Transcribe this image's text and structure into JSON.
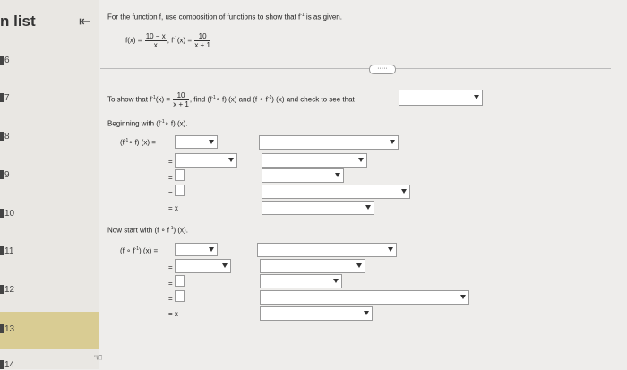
{
  "sidebar": {
    "title": "n list",
    "items": [
      {
        "label": "6"
      },
      {
        "label": "7"
      },
      {
        "label": "8"
      },
      {
        "label": "9"
      },
      {
        "label": "10"
      },
      {
        "label": "11"
      },
      {
        "label": "12"
      },
      {
        "label": "13"
      },
      {
        "label": "14"
      }
    ],
    "collapse_icon": "collapse-left-icon",
    "active_color": "#d9cc93"
  },
  "problem": {
    "instruction_1": "For the function f, use composition of functions to show that f",
    "instruction_1_sup": "-1",
    "instruction_1_end": "is as given.",
    "f_lhs": "f(x) =",
    "f_num": "10 − x",
    "f_den": "x",
    "sep": ",",
    "finv_lhs_f": "f",
    "finv_lhs_sup": "-1",
    "finv_lhs_x": "(x) =",
    "finv_num": "10",
    "finv_den": "x + 1",
    "more_label": "·····",
    "show_text_1": "To show that f",
    "show_sup": "-1",
    "show_text_2": "(x) =",
    "show_num": "10",
    "show_den": "x + 1",
    "show_text_3": ", find",
    "comp1": "(f",
    "comp1_sup": "-1",
    "comp1_end": "∘ f) (x) and",
    "comp2": "(f ∘ f",
    "comp2_sup": "-1",
    "comp2_end": ") (x) and check to see that",
    "begin_text": "Beginning with (f",
    "begin_sup": "-1",
    "begin_end": "∘ f) (x).",
    "lhs1": "(f",
    "lhs1_sup": "-1",
    "lhs1_end": "∘ f) (x) =",
    "eq": "=",
    "eqx": "= x",
    "now_text": "Now start with (f ∘ f",
    "now_sup": "-1",
    "now_end": ") (x).",
    "lhs2": "(f ∘ f",
    "lhs2_sup": "-1",
    "lhs2_end": ") (x) ="
  }
}
